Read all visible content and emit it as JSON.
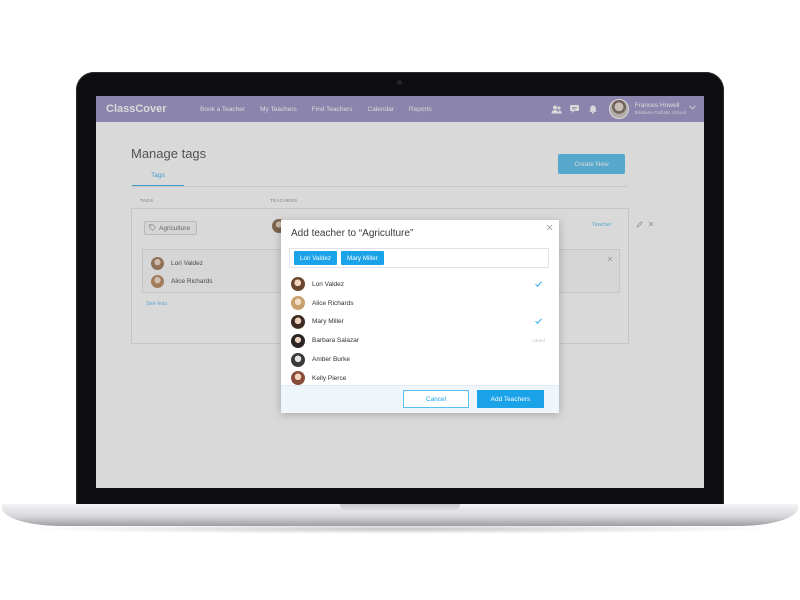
{
  "navbar": {
    "logo": "ClassCover",
    "links": [
      "Book a Teacher",
      "My Teachers",
      "Find Teachers",
      "Calendar",
      "Reports"
    ],
    "user": {
      "name": "Frances Howell",
      "school": "Brisbane Catholic School"
    },
    "color": "#9b93c4"
  },
  "page": {
    "title": "Manage tags",
    "create_button": "Create New",
    "tab": "Tags",
    "columns": {
      "tags": "TAGS",
      "teachers": "TEACHERS"
    },
    "tag_row": {
      "tag": "Agriculture",
      "teacher_link": "Teacher",
      "teachers": [
        "Lori Valdez",
        "Alice Richards"
      ],
      "see_less": "See less"
    }
  },
  "modal": {
    "title": "Add teacher to “Agriculture”",
    "selected": [
      "Lori Valdez",
      "Mary Miller"
    ],
    "teachers": [
      {
        "name": "Lori Valdez",
        "checked": true,
        "added": false
      },
      {
        "name": "Alice Richards",
        "checked": false,
        "added": false
      },
      {
        "name": "Mary Miller",
        "checked": true,
        "added": false
      },
      {
        "name": "Barbara Salazar",
        "checked": false,
        "added": true
      },
      {
        "name": "Amber Burke",
        "checked": false,
        "added": false
      },
      {
        "name": "Kelly Pierce",
        "checked": false,
        "added": false
      }
    ],
    "added_label": "Added",
    "cancel": "Cancel",
    "submit": "Add Teachers",
    "accent": "#1aa3e8"
  }
}
